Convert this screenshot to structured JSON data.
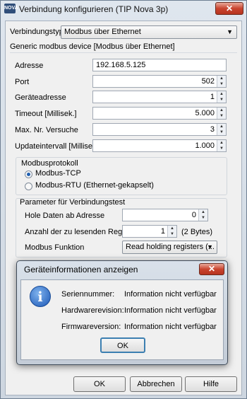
{
  "window": {
    "title": "Verbindung konfigurieren (TIP Nova 3p)",
    "icon_text": "NOVA",
    "close_symbol": "✕"
  },
  "connection": {
    "type_label": "Verbindungstyp",
    "type_value": "Modbus über Ethernet",
    "device_heading": "Generic modbus device [Modbus über Ethernet]"
  },
  "fields": {
    "address_label": "Adresse",
    "address_value": "192.168.5.125",
    "port_label": "Port",
    "port_value": "502",
    "device_address_label": "Geräteadresse",
    "device_address_value": "1",
    "timeout_label": "Timeout [Millisek.]",
    "timeout_value": "5.000",
    "retries_label": "Max. Nr. Versuche",
    "retries_value": "3",
    "update_label": "Updateintervall [Millisek.]",
    "update_value": "1.000"
  },
  "protocol": {
    "group_label": "Modbusprotokoll",
    "tcp_label": "Modbus-TCP",
    "rtu_label": "Modbus-RTU (Ethernet-gekapselt)",
    "selected": "Modbus-TCP"
  },
  "test": {
    "group_label": "Parameter für Verbindungstest",
    "start_label": "Hole Daten ab Adresse",
    "start_value": "0",
    "count_label": "Anzahl der zu lesenden Register",
    "count_value": "1",
    "count_unit": "(2 Bytes)",
    "function_label": "Modbus Funktion",
    "function_value": "Read holding registers (..."
  },
  "buttons": {
    "ok": "OK",
    "cancel": "Abbrechen",
    "help": "Hilfe"
  },
  "dialog": {
    "title": "Geräteinformationen anzeigen",
    "close_symbol": "✕",
    "info_icon_glyph": "i",
    "serial_label": "Seriennummer:",
    "serial_value": "Information nicht verfügbar",
    "hardware_label": "Hardwarerevision:",
    "hardware_value": "Information nicht verfügbar",
    "firmware_label": "Firmwareversion:",
    "firmware_value": "Information nicht verfügbar",
    "ok": "OK"
  }
}
